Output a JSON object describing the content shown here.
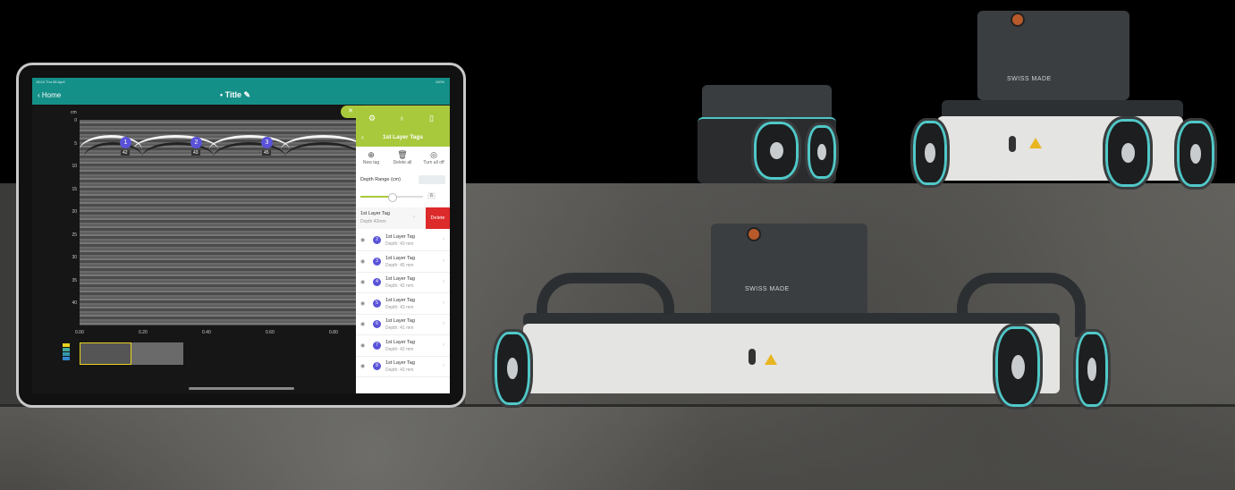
{
  "app": {
    "status_left": "18:04 Thu 08 April",
    "status_right": "100%",
    "nav_back": "Home",
    "nav_title": "Title",
    "y_unit": "cm",
    "y_ticks": [
      "0",
      "5",
      "10",
      "15",
      "20",
      "25",
      "30",
      "35",
      "40"
    ],
    "x_ticks": [
      "0.00",
      "0.20",
      "0.40",
      "0.60",
      "0.80"
    ],
    "markers": [
      {
        "num": "1",
        "label": "42"
      },
      {
        "num": "2",
        "label": "43"
      },
      {
        "num": "3",
        "label": "45"
      }
    ]
  },
  "panel": {
    "close": "✕",
    "header": "1st Layer Tags",
    "actions": [
      {
        "icon": "⊕",
        "label": "New tag"
      },
      {
        "icon": "🗑",
        "label": "Delete all"
      },
      {
        "icon": "◎",
        "label": "Turn all off"
      }
    ],
    "depth_range_label": "Depth Range (cm)",
    "slider_value": "6",
    "first_tag": {
      "name": "1st Layer Tag",
      "depth": "Depth 42mm",
      "delete": "Delete"
    },
    "tags": [
      {
        "num": "2",
        "name": "1st Layer Tag",
        "depth": "Depth: 43 mm"
      },
      {
        "num": "3",
        "name": "1st Layer Tag",
        "depth": "Depth: 45 mm"
      },
      {
        "num": "4",
        "name": "1st Layer Tag",
        "depth": "Depth: 42 mm"
      },
      {
        "num": "5",
        "name": "1st Layer Tag",
        "depth": "Depth: 43 mm"
      },
      {
        "num": "6",
        "name": "1st Layer Tag",
        "depth": "Depth: 41 mm"
      },
      {
        "num": "7",
        "name": "1st Layer Tag",
        "depth": "Depth: 42 mm"
      },
      {
        "num": "8",
        "name": "1st Layer Tag",
        "depth": "Depth: 43 mm"
      }
    ]
  },
  "devices": {
    "brand_label": "SWISS MADE"
  },
  "colors": {
    "accent_teal": "#149088",
    "panel_green": "#a9c93d",
    "tag_purple": "#5a53d8",
    "delete_red": "#dd2a2a"
  }
}
